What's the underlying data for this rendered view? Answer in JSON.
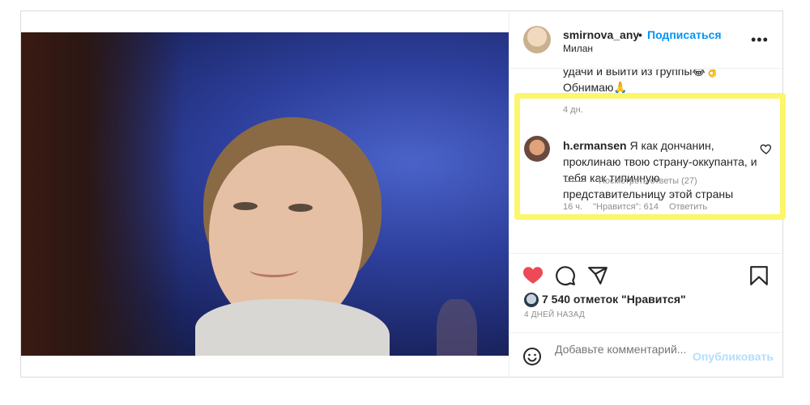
{
  "post": {
    "photo_alt": "",
    "header": {
      "username": "smirnova_any",
      "separator": "•",
      "follow_label": "Подписаться",
      "location": "Милан",
      "more_label": "•••"
    },
    "previous_comment": {
      "text": "удачи и выйти из группы😂👌 Обнимаю🙏",
      "time": "4 дн."
    },
    "highlighted_comment": {
      "username": "h.ermansen",
      "text": "Я как дончанин, проклинаю твою страну-оккупанта, и тебя как типичную представительницу этой страны",
      "time": "16 ч.",
      "likes": "\"Нравится\": 614",
      "reply_label": "Ответить"
    },
    "view_replies": "Посмотреть ответы (27)",
    "likes_count": "7 540 отметок \"Нравится\"",
    "posted_ago": "4 ДНЕЙ НАЗАД",
    "add_comment": {
      "placeholder": "Добавьте комментарий...",
      "publish_label": "Опубликовать"
    },
    "colors": {
      "accent": "#0095f6",
      "liked_heart": "#ed4956",
      "highlight": "#fbf66a"
    },
    "icons": [
      "heart-icon",
      "comment-icon",
      "share-icon",
      "bookmark-icon",
      "emoji-icon",
      "more-icon"
    ]
  }
}
